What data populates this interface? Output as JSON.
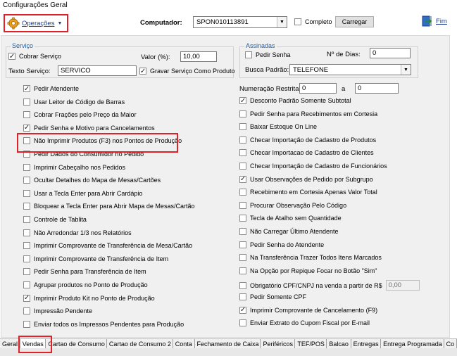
{
  "window": {
    "title": "Configurações Geral"
  },
  "toolbar": {
    "operacoes_label": "Operações",
    "computador_label": "Computador:",
    "computador_value": "SPON010113891",
    "completo_label": "Completo",
    "completo_checked": false,
    "carregar_label": "Carregar",
    "fim_label": "Fim"
  },
  "servico": {
    "legend": "Serviço",
    "cobrar_label": "Cobrar Serviço",
    "cobrar_checked": true,
    "valor_label": "Valor (%):",
    "valor_value": "10,00",
    "texto_label": "Texto Serviço:",
    "texto_value": "SERVICO",
    "gravar_label": "Gravar Serviço Como Produto",
    "gravar_checked": true
  },
  "assinadas": {
    "legend": "Assinadas",
    "pedir_senha_label": "Pedir Senha",
    "pedir_senha_checked": false,
    "dias_label": "Nº de Dias:",
    "dias_value": "0",
    "busca_label": "Busca Padrão:",
    "busca_value": "TELEFONE"
  },
  "left_options": [
    {
      "label": "Pedir Atendente",
      "checked": true
    },
    {
      "label": "Usar Leitor de Código de Barras",
      "checked": false
    },
    {
      "label": "Cobrar Frações pelo Preço da Maior",
      "checked": false
    },
    {
      "label": "Pedir Senha e Motivo para Cancelamentos",
      "checked": true
    },
    {
      "label": "Não Imprimir Produtos (F3) nos Pontos de Produção",
      "checked": false
    },
    {
      "label": "Pedir Dados do Consumidor no Pedido",
      "checked": false
    },
    {
      "label": "Imprimir Cabeçalho nos Pedidos",
      "checked": false
    },
    {
      "label": "Ocultar Detalhes do Mapa de Mesas/Cartões",
      "checked": false
    },
    {
      "label": "Usar a Tecla Enter para Abrir Cardápio",
      "checked": false
    },
    {
      "label": "Bloquear a Tecla Enter para Abrir Mapa de Mesas/Cartão",
      "checked": false
    },
    {
      "label": "Controle de Tablita",
      "checked": false
    },
    {
      "label": "Não Arredondar 1/3 nos Relatórios",
      "checked": false
    },
    {
      "label": "Imprimir Comprovante de Transferência de Mesa/Cartão",
      "checked": false
    },
    {
      "label": "Imprimir Comprovante de Transferência de Item",
      "checked": false
    },
    {
      "label": "Pedir Senha para Transferência de Item",
      "checked": false
    },
    {
      "label": "Agrupar produtos no Ponto de Produção",
      "checked": false
    },
    {
      "label": "Imprimir Produto Kit no Ponto de Produção",
      "checked": true
    },
    {
      "label": "Impressão Pendente",
      "checked": false
    },
    {
      "label": "Enviar todos os Impressos Pendentes para Produção",
      "checked": false
    }
  ],
  "numeracao": {
    "label": "Numeração Restrita:",
    "from": "0",
    "to_label": "a",
    "to": "0"
  },
  "right_options": [
    {
      "label": "Desconto Padrão Somente Subtotal",
      "checked": true
    },
    {
      "label": "Pedir Senha para Recebimentos em Cortesia",
      "checked": false
    },
    {
      "label": "Baixar Estoque On Line",
      "checked": false
    },
    {
      "label": "Checar Importação de Cadastro de Produtos",
      "checked": false
    },
    {
      "label": "Checar Importacao de Cadastro de Clientes",
      "checked": false
    },
    {
      "label": "Checar Importação de Cadastro de Funcionários",
      "checked": false
    },
    {
      "label": "Usar Observações de Pedido por Subgrupo",
      "checked": true
    },
    {
      "label": "Recebimento em Cortesia Apenas Valor Total",
      "checked": false
    },
    {
      "label": "Procurar Observação Pelo Código",
      "checked": false
    },
    {
      "label": "Tecla de Atalho sem Quantidade",
      "checked": false
    },
    {
      "label": "Não Carregar Último Atendente",
      "checked": false
    },
    {
      "label": "Pedir Senha do Atendente",
      "checked": false
    },
    {
      "label": "Na Transferência Trazer Todos Itens Marcados",
      "checked": false
    },
    {
      "label": "Na Opção por Repique Focar no Botão \"Sim\"",
      "checked": false
    },
    {
      "label": "Obrigatório CPF/CNPJ na venda a partir de R$",
      "checked": false,
      "value": "0,00"
    },
    {
      "label": "Pedir Somente CPF",
      "checked": false
    },
    {
      "label": "Imprimir Comprovante de Cancelamento (F9)",
      "checked": true
    },
    {
      "label": "Enviar Extrato do Cupom Fiscal por E-mail",
      "checked": false
    }
  ],
  "tabs": [
    {
      "label": "Geral",
      "active": false
    },
    {
      "label": "Vendas",
      "active": true
    },
    {
      "label": "Cartao de Consumo",
      "active": false
    },
    {
      "label": "Cartao de Consumo 2",
      "active": false
    },
    {
      "label": "Conta",
      "active": false
    },
    {
      "label": "Fechamento de Caixa",
      "active": false
    },
    {
      "label": "Periféricos",
      "active": false
    },
    {
      "label": "TEF/POS",
      "active": false
    },
    {
      "label": "Balcao",
      "active": false
    },
    {
      "label": "Entregas",
      "active": false
    },
    {
      "label": "Entrega Programada",
      "active": false
    },
    {
      "label": "Co",
      "active": false
    }
  ],
  "colors": {
    "highlight": "#e0212a",
    "legend": "#1f5fa8",
    "link": "#1a3c8f"
  }
}
